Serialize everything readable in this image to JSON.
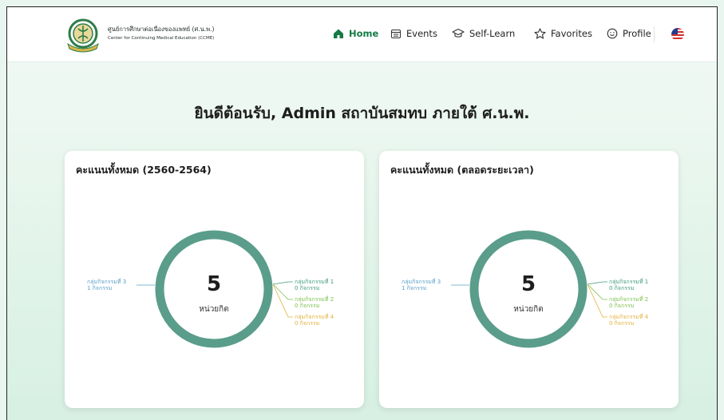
{
  "brand": {
    "name_th": "ศูนย์การศึกษาต่อเนื่องของแพทย์ (ศ.น.พ.)",
    "name_en": "Center for Continuing Medical Education (CCME)"
  },
  "nav": {
    "items": [
      {
        "label": "Home",
        "icon": "home-icon",
        "active": true
      },
      {
        "label": "Events",
        "icon": "calendar-icon",
        "active": false
      },
      {
        "label": "Self-Learn",
        "icon": "graduation-cap-icon",
        "active": false
      },
      {
        "label": "Favorites",
        "icon": "star-icon",
        "active": false
      },
      {
        "label": "Profile",
        "icon": "smile-icon",
        "active": false
      }
    ],
    "language_icon": "us-flag-icon"
  },
  "welcome_text": "ยินดีต้อนรับ, Admin สถาบันสมทบ ภายใต้ ศ.น.พ.",
  "colors": {
    "accent": "#157a45",
    "ring": "#5a9d8a",
    "group1": "#3f9c78",
    "group2": "#7dbf4a",
    "group3": "#5aa0c8",
    "group4": "#e2b13c"
  },
  "cards": [
    {
      "title": "คะแนนทั้งหมด (2560-2564)",
      "chart_data": {
        "type": "pie",
        "total_value": "5",
        "total_unit": "หน่วยกิต",
        "slices": [
          {
            "label": "กลุ่มกิจกรรมที่ 3",
            "value_text": "1 กิจกรรม",
            "value": 1,
            "side": "left"
          },
          {
            "label": "กลุ่มกิจกรรมที่ 1",
            "value_text": "0 กิจกรรม",
            "value": 0,
            "side": "right"
          },
          {
            "label": "กลุ่มกิจกรรมที่ 2",
            "value_text": "0 กิจกรรม",
            "value": 0,
            "side": "right"
          },
          {
            "label": "กลุ่มกิจกรรมที่ 4",
            "value_text": "0 กิจกรรม",
            "value": 0,
            "side": "right"
          }
        ]
      }
    },
    {
      "title": "คะแนนทั้งหมด (ตลอดระยะเวลา)",
      "chart_data": {
        "type": "pie",
        "total_value": "5",
        "total_unit": "หน่วยกิต",
        "slices": [
          {
            "label": "กลุ่มกิจกรรมที่ 3",
            "value_text": "1 กิจกรรม",
            "value": 1,
            "side": "left"
          },
          {
            "label": "กลุ่มกิจกรรมที่ 1",
            "value_text": "0 กิจกรรม",
            "value": 0,
            "side": "right"
          },
          {
            "label": "กลุ่มกิจกรรมที่ 2",
            "value_text": "0 กิจกรรม",
            "value": 0,
            "side": "right"
          },
          {
            "label": "กลุ่มกิจกรรมที่ 4",
            "value_text": "0 กิจกรรม",
            "value": 0,
            "side": "right"
          }
        ]
      }
    }
  ]
}
